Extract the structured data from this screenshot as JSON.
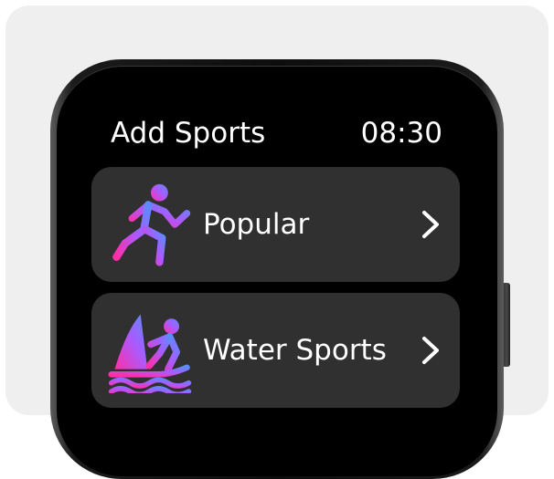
{
  "header": {
    "title": "Add Sports",
    "time": "08:30"
  },
  "categories": [
    {
      "label": "Popular",
      "icon": "running-person-icon"
    },
    {
      "label": "Water Sports",
      "icon": "windsurfing-icon"
    }
  ],
  "colors": {
    "background": "#efefef",
    "screen": "#000000",
    "card": "#303030",
    "text": "#ffffff",
    "icon_gradient_start": "#ff2ea6",
    "icon_gradient_end": "#5b8cff"
  }
}
